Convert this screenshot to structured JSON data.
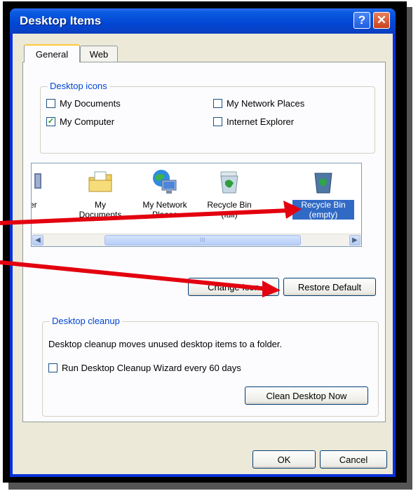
{
  "window": {
    "title": "Desktop Items"
  },
  "titlebar_buttons": {
    "help": "?",
    "close": "✕"
  },
  "tabs": [
    {
      "label": "General"
    },
    {
      "label": "Web"
    }
  ],
  "desktop_icons": {
    "title": "Desktop icons",
    "items": [
      {
        "label": "My Documents",
        "checked": false
      },
      {
        "label": "My Network Places",
        "checked": false
      },
      {
        "label": "My Computer",
        "checked": true
      },
      {
        "label": "Internet Explorer",
        "checked": false
      }
    ]
  },
  "icon_list": {
    "items": [
      {
        "label": "outer",
        "icon": "computer-icon"
      },
      {
        "label": "My\nDocuments",
        "icon": "documents-folder-icon"
      },
      {
        "label": "My Network\nPlaces",
        "icon": "network-places-icon"
      },
      {
        "label": "Recycle Bin\n(full)",
        "icon": "recycle-bin-full-icon"
      },
      {
        "label": "Recycle Bin\n(empty)",
        "icon": "recycle-bin-empty-icon",
        "selected": true
      }
    ],
    "scroll_thumb_mark": "III"
  },
  "buttons": {
    "change_icon": "Change Icon",
    "restore_default": "Restore Default",
    "clean_desktop_now": "Clean Desktop Now",
    "ok": "OK",
    "cancel": "Cancel"
  },
  "desktop_cleanup": {
    "title": "Desktop cleanup",
    "description": "Desktop cleanup moves unused desktop items to a folder.",
    "wizard_label": "Run Desktop Cleanup Wizard every 60 days",
    "wizard_checked": false
  },
  "colors": {
    "title_bar": "#0246d4",
    "dialog_bg": "#ece9d8",
    "group_title": "#0046d5",
    "selection": "#316ac5",
    "annotation_arrow": "#e3000f"
  }
}
